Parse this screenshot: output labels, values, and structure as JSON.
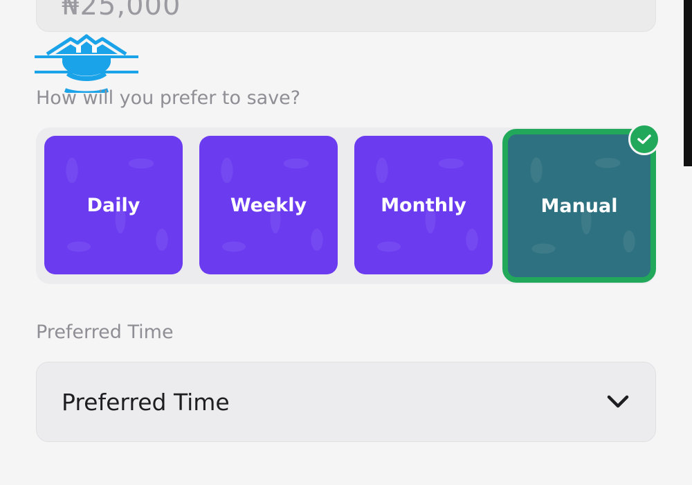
{
  "amount_field": {
    "value": "₦25,000"
  },
  "save_section": {
    "label": "How will you prefer to save?",
    "options": [
      {
        "label": "Daily",
        "selected": false
      },
      {
        "label": "Weekly",
        "selected": false
      },
      {
        "label": "Monthly",
        "selected": false
      },
      {
        "label": "Manual",
        "selected": true
      }
    ],
    "selected_icon": "check-icon"
  },
  "time_section": {
    "label": "Preferred Time",
    "dropdown": {
      "value": "Preferred Time",
      "icon": "chevron-down-icon"
    }
  },
  "colors": {
    "option_purple": "#6b3bf0",
    "selected_fill": "#2e7180",
    "selected_border": "#22a85a",
    "watermark_blue": "#1aa3e8"
  }
}
